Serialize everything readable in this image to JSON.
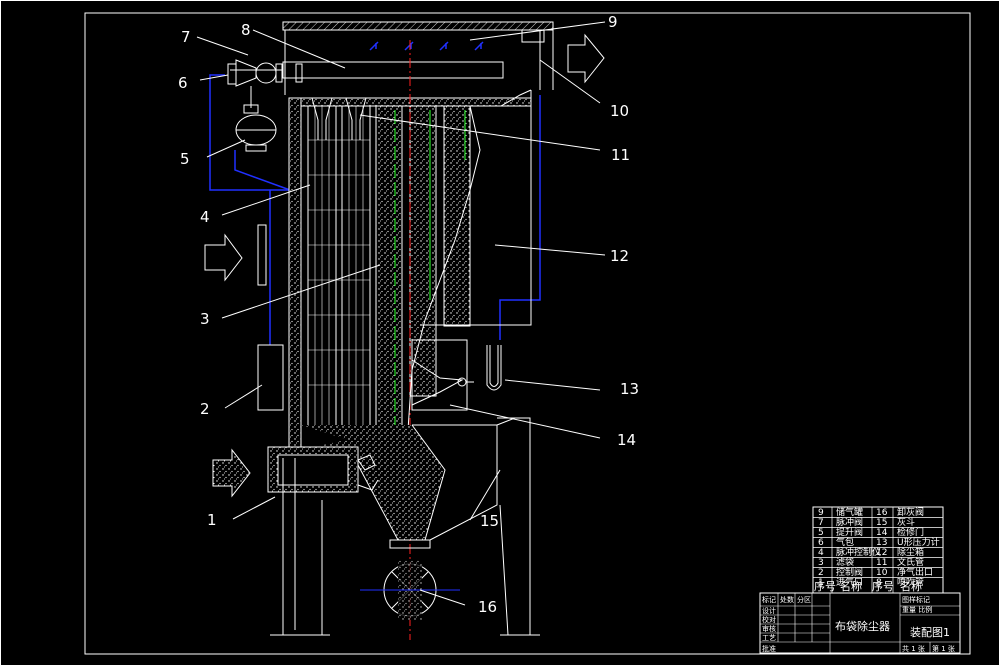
{
  "title_block": {
    "drawing_name": "布袋除尘器",
    "drawing_number": "装配图1",
    "sheet_total": "共 1 张",
    "sheet_index": "第 1 张",
    "header_labels": [
      "标记",
      "处数",
      "分区"
    ],
    "side_labels": [
      "设计",
      "校对",
      "审核",
      "工艺",
      "批准"
    ],
    "sub_labels": [
      "图样标记",
      "重量  比例"
    ]
  },
  "parts_list": {
    "header": {
      "no": "序号",
      "name": "名称",
      "no2": "序号",
      "name2": "名称"
    },
    "rows": [
      {
        "left_no": "9",
        "left_name": "储气罐",
        "right_no": "16",
        "right_name": "卸灰阀"
      },
      {
        "left_no": "7",
        "left_name": "脉冲阀",
        "right_no": "15",
        "right_name": "灰斗"
      },
      {
        "left_no": "5",
        "left_name": "提升阀",
        "right_no": "14",
        "right_name": "检修门"
      },
      {
        "left_no": "6",
        "left_name": "气包",
        "right_no": "13",
        "right_name": "U形压力计"
      },
      {
        "left_no": "4",
        "left_name": "脉冲控制仪",
        "right_no": "12",
        "right_name": "除尘箱"
      },
      {
        "left_no": "3",
        "left_name": "滤袋",
        "right_no": "11",
        "right_name": "文氏管"
      },
      {
        "left_no": "2",
        "left_name": "控制阀",
        "right_no": "10",
        "right_name": "净气出口"
      },
      {
        "left_no": "1",
        "left_name": "进气口",
        "right_no": "8",
        "right_name": "喷吹管"
      }
    ]
  },
  "callouts": [
    "1",
    "2",
    "3",
    "4",
    "5",
    "6",
    "7",
    "8",
    "9",
    "10",
    "11",
    "12",
    "13",
    "14",
    "15",
    "16"
  ],
  "colors": {
    "background": "#000000",
    "lines": "#ffffff",
    "centerline": "#ff2020",
    "green": "#22cc22",
    "blue": "#2030ff"
  }
}
